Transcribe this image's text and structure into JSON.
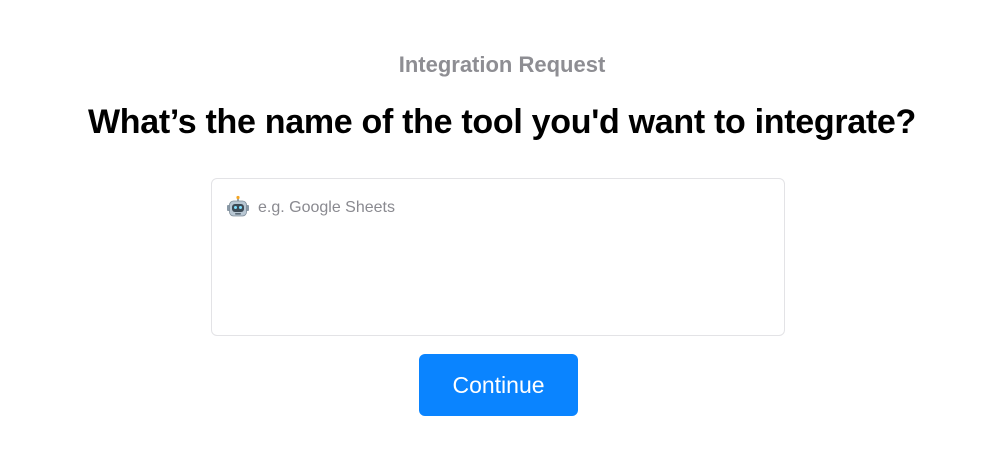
{
  "header": {
    "eyebrow": "Integration Request",
    "headline": "What’s the name of the tool you'd want to integrate?"
  },
  "form": {
    "input_icon": "robot-icon",
    "input_value": "",
    "input_placeholder": "e.g. Google Sheets",
    "continue_label": "Continue"
  },
  "colors": {
    "accent": "#0a84ff",
    "eyebrow_text": "#8e8e93",
    "headline_text": "#000000",
    "input_border": "#e3e3e6"
  }
}
